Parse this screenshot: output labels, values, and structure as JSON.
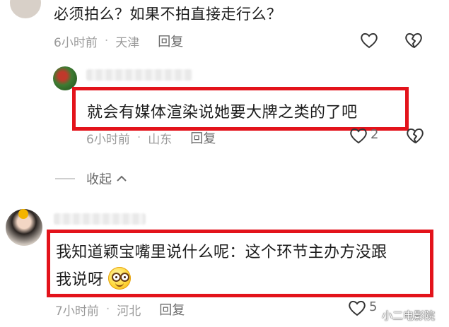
{
  "comments": [
    {
      "text": "必须拍么？如果不拍直接走行么？",
      "time": "6小时前",
      "location": "天津",
      "reply_label": "回复"
    },
    {
      "text": "就会有媒体渲染说她要大牌之类的了吧",
      "time": "6小时前",
      "location": "山东",
      "reply_label": "回复",
      "like_count": "2"
    },
    {
      "text_line1": "我知道颖宝嘴里说什么呢：这个环节主办方没跟",
      "text_line2": "我说呀",
      "time": "7小时前",
      "location": "河北",
      "reply_label": "回复",
      "like_count": "5"
    }
  ],
  "collapse": {
    "label": "收起"
  },
  "separator": "·",
  "watermark": "小二电影院",
  "colors": {
    "highlight_border": "#e3131b",
    "muted_text": "#9a9a9a"
  },
  "icons": [
    "heart-icon",
    "broken-heart-icon",
    "chevron-up-icon",
    "smiley-emoji"
  ]
}
